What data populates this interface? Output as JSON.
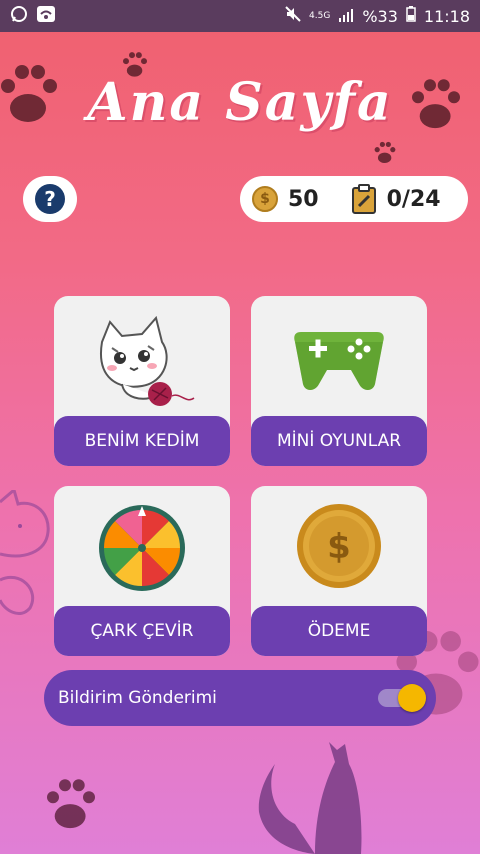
{
  "status_bar": {
    "network": "4.5G",
    "battery": "%33",
    "time": "11:18"
  },
  "header": {
    "title": "Ana Sayfa"
  },
  "stats": {
    "coins": "50",
    "tasks": "0/24"
  },
  "help": {
    "label": "?"
  },
  "cards": [
    {
      "label": "BENİM KEDİM",
      "icon": "cat-icon"
    },
    {
      "label": "MİNİ OYUNLAR",
      "icon": "gamepad-icon"
    },
    {
      "label": "ÇARK ÇEVİR",
      "icon": "wheel-icon"
    },
    {
      "label": "ÖDEME",
      "icon": "dollar-coin-icon"
    }
  ],
  "notification": {
    "label": "Bildirim Gönderimi",
    "enabled": true
  },
  "colors": {
    "accent": "#6c3fb0",
    "toggle_knob": "#f5b700",
    "background_top": "#f0606e",
    "background_bottom": "#e07fd6"
  }
}
